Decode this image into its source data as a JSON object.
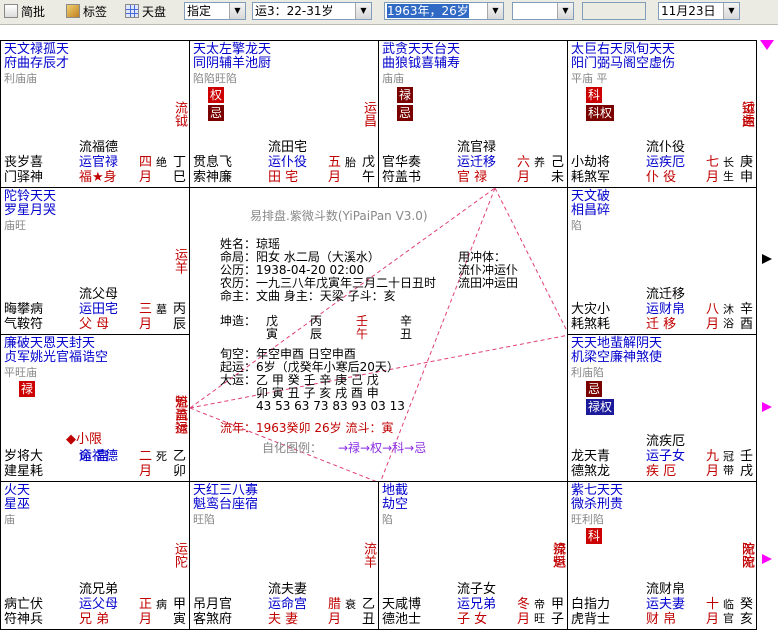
{
  "toolbar": {
    "jianpi": "简批",
    "biaoqian": "标签",
    "tianpan": "天盘",
    "mode": "指定",
    "yun": "运3：22-31岁",
    "year": "1963年，26岁",
    "date": "11月23日"
  },
  "center": {
    "title": "易排盘.紫微斗数(YiPaiPan V3.0)",
    "l1": "姓名：琼瑶",
    "l2": "命局：阳女 水二局（大溪水）",
    "l3": "公历：1938-04-20 02:00",
    "l4": "农历：一九三八年戊寅年三月二十日丑时",
    "l5": "命主：文曲  身主：天梁  子斗：亥",
    "r1": "用冲体：",
    "r2": "流仆冲运仆",
    "r3": "流田冲运田",
    "kz": "坤造：",
    "g1": "戊",
    "g2": "丙",
    "g3": "壬",
    "g4": "辛",
    "z1": "寅",
    "z2": "辰",
    "z3": "午",
    "z4": "丑",
    "xk": "旬空：年空申酉   日空申酉",
    "qy": "起运：6岁（戊癸年小寒后20天）",
    "dy": "大运：乙 甲 癸 壬 辛 庚 己 戊",
    "dy2": "卯 寅 丑 子 亥 戌 酉 申",
    "dy3": "43 53 63 73 83 93 03 13",
    "ln": "流年：1963癸卯  26岁  流斗：寅",
    "zh": "自化图例：",
    "zh2": "→禄→权→科→忌"
  },
  "palaces": [
    {
      "stars": "天文禄孤天",
      "stars2": "府曲存辰才",
      "bright": "利庙庙",
      "mid": "流钺",
      "bl1": "流福德",
      "bl2": "运官禄",
      "bl3": "福★身",
      "bottom": "丧岁喜",
      "bottom2": "门驿神",
      "ageA": "四",
      "ageB": "月",
      "sheng": "绝",
      "sheng2": "",
      "gz": "丁",
      "gz2": "巳"
    },
    {
      "stars": "天太左擎龙天",
      "stars2": "同阴辅羊池厨",
      "bright": "陷陷旺陷",
      "b1": "权",
      "b2": "忌",
      "mid": "运昌",
      "bl1": "流田宅",
      "bl2": "运仆役",
      "bl3": "田  宅",
      "bottom": "贯息飞",
      "bottom2": "索神廉",
      "ageA": "五",
      "ageB": "月",
      "sheng": "胎",
      "gz": "戊",
      "gz2": "午"
    },
    {
      "stars": "武贪天天台天",
      "stars2": "曲狼钺喜辅寿",
      "bright": "庙庙",
      "b1": "禄",
      "b2": "忌",
      "bl1": "流官禄",
      "bl2": "运迁移",
      "bl3": "官  禄",
      "bottom": "官华奏",
      "bottom2": "符盖书",
      "ageA": "六",
      "ageB": "月",
      "sheng": "养",
      "gz": "己",
      "gz2": "未"
    },
    {
      "stars": "太巨右天凤旬天天",
      "stars2": "阳门弼马阁空虚伤",
      "bright": "平庙  平",
      "b1": "科",
      "b2": "科权",
      "mid": "运运",
      "mid2": "钺曲",
      "bl1": "流仆役",
      "bl2": "运疾厄",
      "bl3": "仆  役",
      "bottom": "小劫将",
      "bottom2": "耗煞军",
      "ageA": "七",
      "ageB": "月",
      "sheng": "长",
      "sheng2": "生",
      "gz": "庚",
      "gz2": "申"
    },
    {
      "stars": "陀铃天天",
      "stars2": "罗星月哭",
      "bright": "庙旺",
      "mid": "运羊",
      "bl1": "流父母",
      "bl2": "运田宅",
      "bl3": "父  母",
      "bottom": "晦攀病",
      "bottom2": "气鞍符",
      "ageA": "三",
      "ageB": "月",
      "sheng": "墓",
      "gz": "丙",
      "gz2": "辰"
    },
    {
      "stars": "天文破",
      "stars2": "相昌碎",
      "bright": "陷",
      "bl1": "流迁移",
      "bl2": "运财帛",
      "bl3": "迁  移",
      "bottom": "大灾小",
      "bottom2": "耗煞耗",
      "ageA": "八",
      "ageB": "月",
      "sheng": "沐",
      "sheng2": "浴",
      "gz": "辛",
      "gz2": "酉"
    },
    {
      "stars": "廉破天恩天封天",
      "stars2": "贞军姚光官福诰空",
      "bright": "平旺庙",
      "b1": "禄",
      "mid": "流流运",
      "mid2": "魁昌禄",
      "bl0": "◆小限",
      "bl1": "运福德",
      "bl2": "命  宫",
      "bottom": "岁将大",
      "bottom2": "建星耗",
      "ageA": "二",
      "ageB": "月",
      "sheng": "死",
      "gz": "乙",
      "gz2": "卯"
    },
    {
      "stars": "天天地蜚解阴天",
      "stars2": "机梁空廉神煞使",
      "bright": "利庙陷",
      "b1": "忌",
      "b2": "禄权",
      "bl1": "流疾厄",
      "bl2": "运子女",
      "bl3": "疾  厄",
      "bottom": "龙天青",
      "bottom2": "德煞龙",
      "ageA": "九",
      "ageB": "月",
      "sheng": "冠",
      "sheng2": "带",
      "gz": "壬",
      "gz2": "戌"
    },
    {
      "stars": "火天",
      "stars2": "星巫",
      "bright": "庙",
      "mid": "运陀",
      "bl1": "流兄弟",
      "bl2": "运父母",
      "bl3": "兄  弟",
      "bottom": "病亡伏",
      "bottom2": "符神兵",
      "ageA": "正",
      "ageB": "月",
      "sheng": "病",
      "gz": "甲",
      "gz2": "寅"
    },
    {
      "stars": "天红三八寡",
      "stars2": "魁鸾台座宿",
      "bright": "旺陷",
      "mid": "流羊",
      "bl1": "流夫妻",
      "bl2": "运命宫",
      "bl3": "夫  妻",
      "bottom": "吊月官",
      "bottom2": "客煞府",
      "ageA": "腊",
      "ageB": "月",
      "sheng": "衰",
      "gz": "乙",
      "gz2": "丑"
    },
    {
      "stars": "地截",
      "stars2": "劫空",
      "bright": "陷",
      "mid": "流运",
      "mid2": "禄魁",
      "bl1": "流子女",
      "bl2": "运兄弟",
      "bl3": "子  女",
      "bottom": "天咸博",
      "bottom2": "德池士",
      "ageA": "冬",
      "ageB": "月",
      "sheng": "帝",
      "sheng2": "旺",
      "gz": "甲",
      "gz2": "子"
    },
    {
      "stars": "紫七天天",
      "stars2": "微杀刑贵",
      "bright": "旺利陷",
      "b1": "科",
      "mid": "流流",
      "mid2": "陀陀",
      "bl1": "流财帛",
      "bl2": "运夫妻",
      "bl3": "财  帛",
      "bottom": "白指力",
      "bottom2": "虎背士",
      "ageA": "十",
      "ageB": "月",
      "sheng": "临",
      "sheng2": "官",
      "gz": "癸",
      "gz2": "亥"
    }
  ]
}
